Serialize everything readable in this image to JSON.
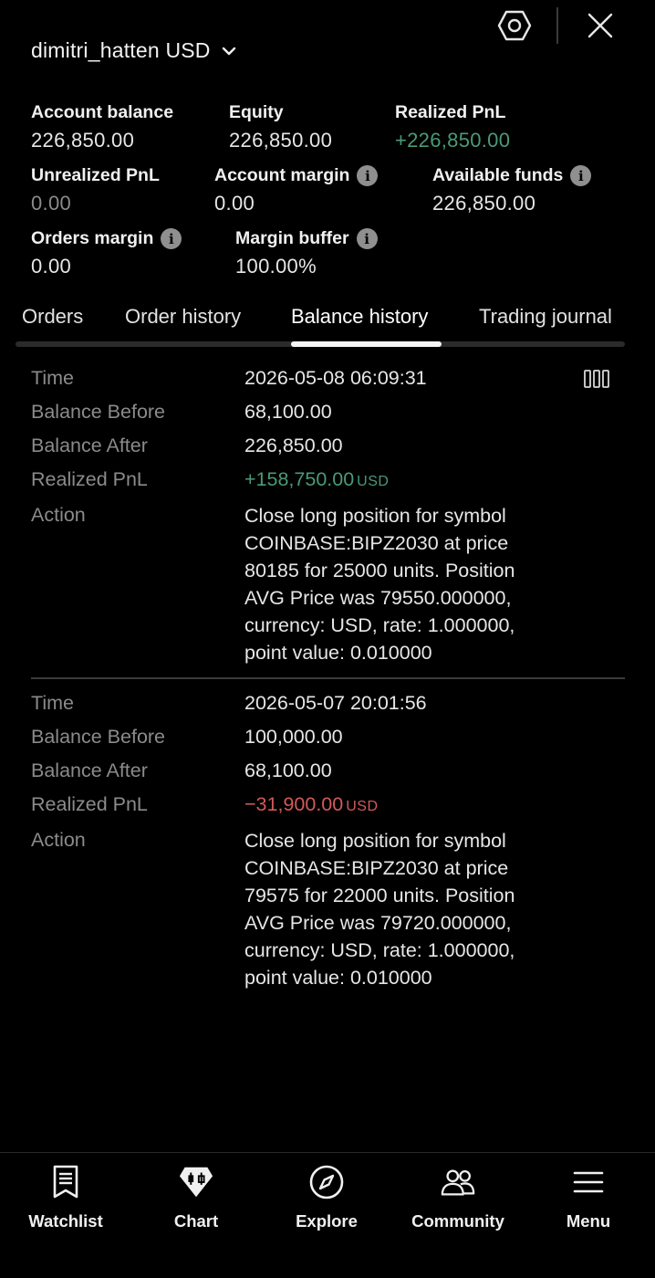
{
  "header": {
    "account_name": "dimitri_hatten USD",
    "icons": [
      "chevron-down-icon",
      "settings-hexagon-icon",
      "close-icon"
    ]
  },
  "stats": {
    "account_balance": {
      "label": "Account balance",
      "value": "226,850.00"
    },
    "equity": {
      "label": "Equity",
      "value": "226,850.00"
    },
    "realized_pnl": {
      "label": "Realized PnL",
      "value": "+226,850.00"
    },
    "unrealized_pnl": {
      "label": "Unrealized PnL",
      "value": "0.00"
    },
    "account_margin": {
      "label": "Account margin",
      "value": "0.00"
    },
    "available_funds": {
      "label": "Available funds",
      "value": "226,850.00"
    },
    "orders_margin": {
      "label": "Orders margin",
      "value": "0.00"
    },
    "margin_buffer": {
      "label": "Margin buffer",
      "value": "100.00%"
    }
  },
  "tabs": [
    {
      "label": "Orders"
    },
    {
      "label": "Order history"
    },
    {
      "label": "Balance history",
      "active": true
    },
    {
      "label": "Trading journal"
    }
  ],
  "field_labels": {
    "time": "Time",
    "balance_before": "Balance Before",
    "balance_after": "Balance After",
    "realized_pnl": "Realized PnL",
    "action": "Action"
  },
  "records": [
    {
      "time": "2026-05-08 06:09:31",
      "balance_before": "68,100.00",
      "balance_after": "226,850.00",
      "realized_pnl": "+158,750.00",
      "pnl_currency": "USD",
      "action": "Close long position for symbol COINBASE:BIPZ2030 at price 80185 for 25000 units. Position AVG Price was 79550.000000, currency: USD, rate: 1.000000, point value: 0.010000"
    },
    {
      "time": "2026-05-07 20:01:56",
      "balance_before": "100,000.00",
      "balance_after": "68,100.00",
      "realized_pnl": "−31,900.00",
      "pnl_currency": "USD",
      "action": "Close long position for symbol COINBASE:BIPZ2030 at price 79575 for 22000 units. Position AVG Price was 79720.000000, currency: USD, rate: 1.000000, point value: 0.010000"
    }
  ],
  "bottom_nav": [
    {
      "label": "Watchlist",
      "icon": "watchlist-icon"
    },
    {
      "label": "Chart",
      "icon": "chart-icon"
    },
    {
      "label": "Explore",
      "icon": "explore-compass-icon"
    },
    {
      "label": "Community",
      "icon": "community-icon"
    },
    {
      "label": "Menu",
      "icon": "menu-icon"
    }
  ],
  "colors": {
    "positive": "#4a9a78",
    "negative": "#d25a5a",
    "background": "#000000"
  }
}
